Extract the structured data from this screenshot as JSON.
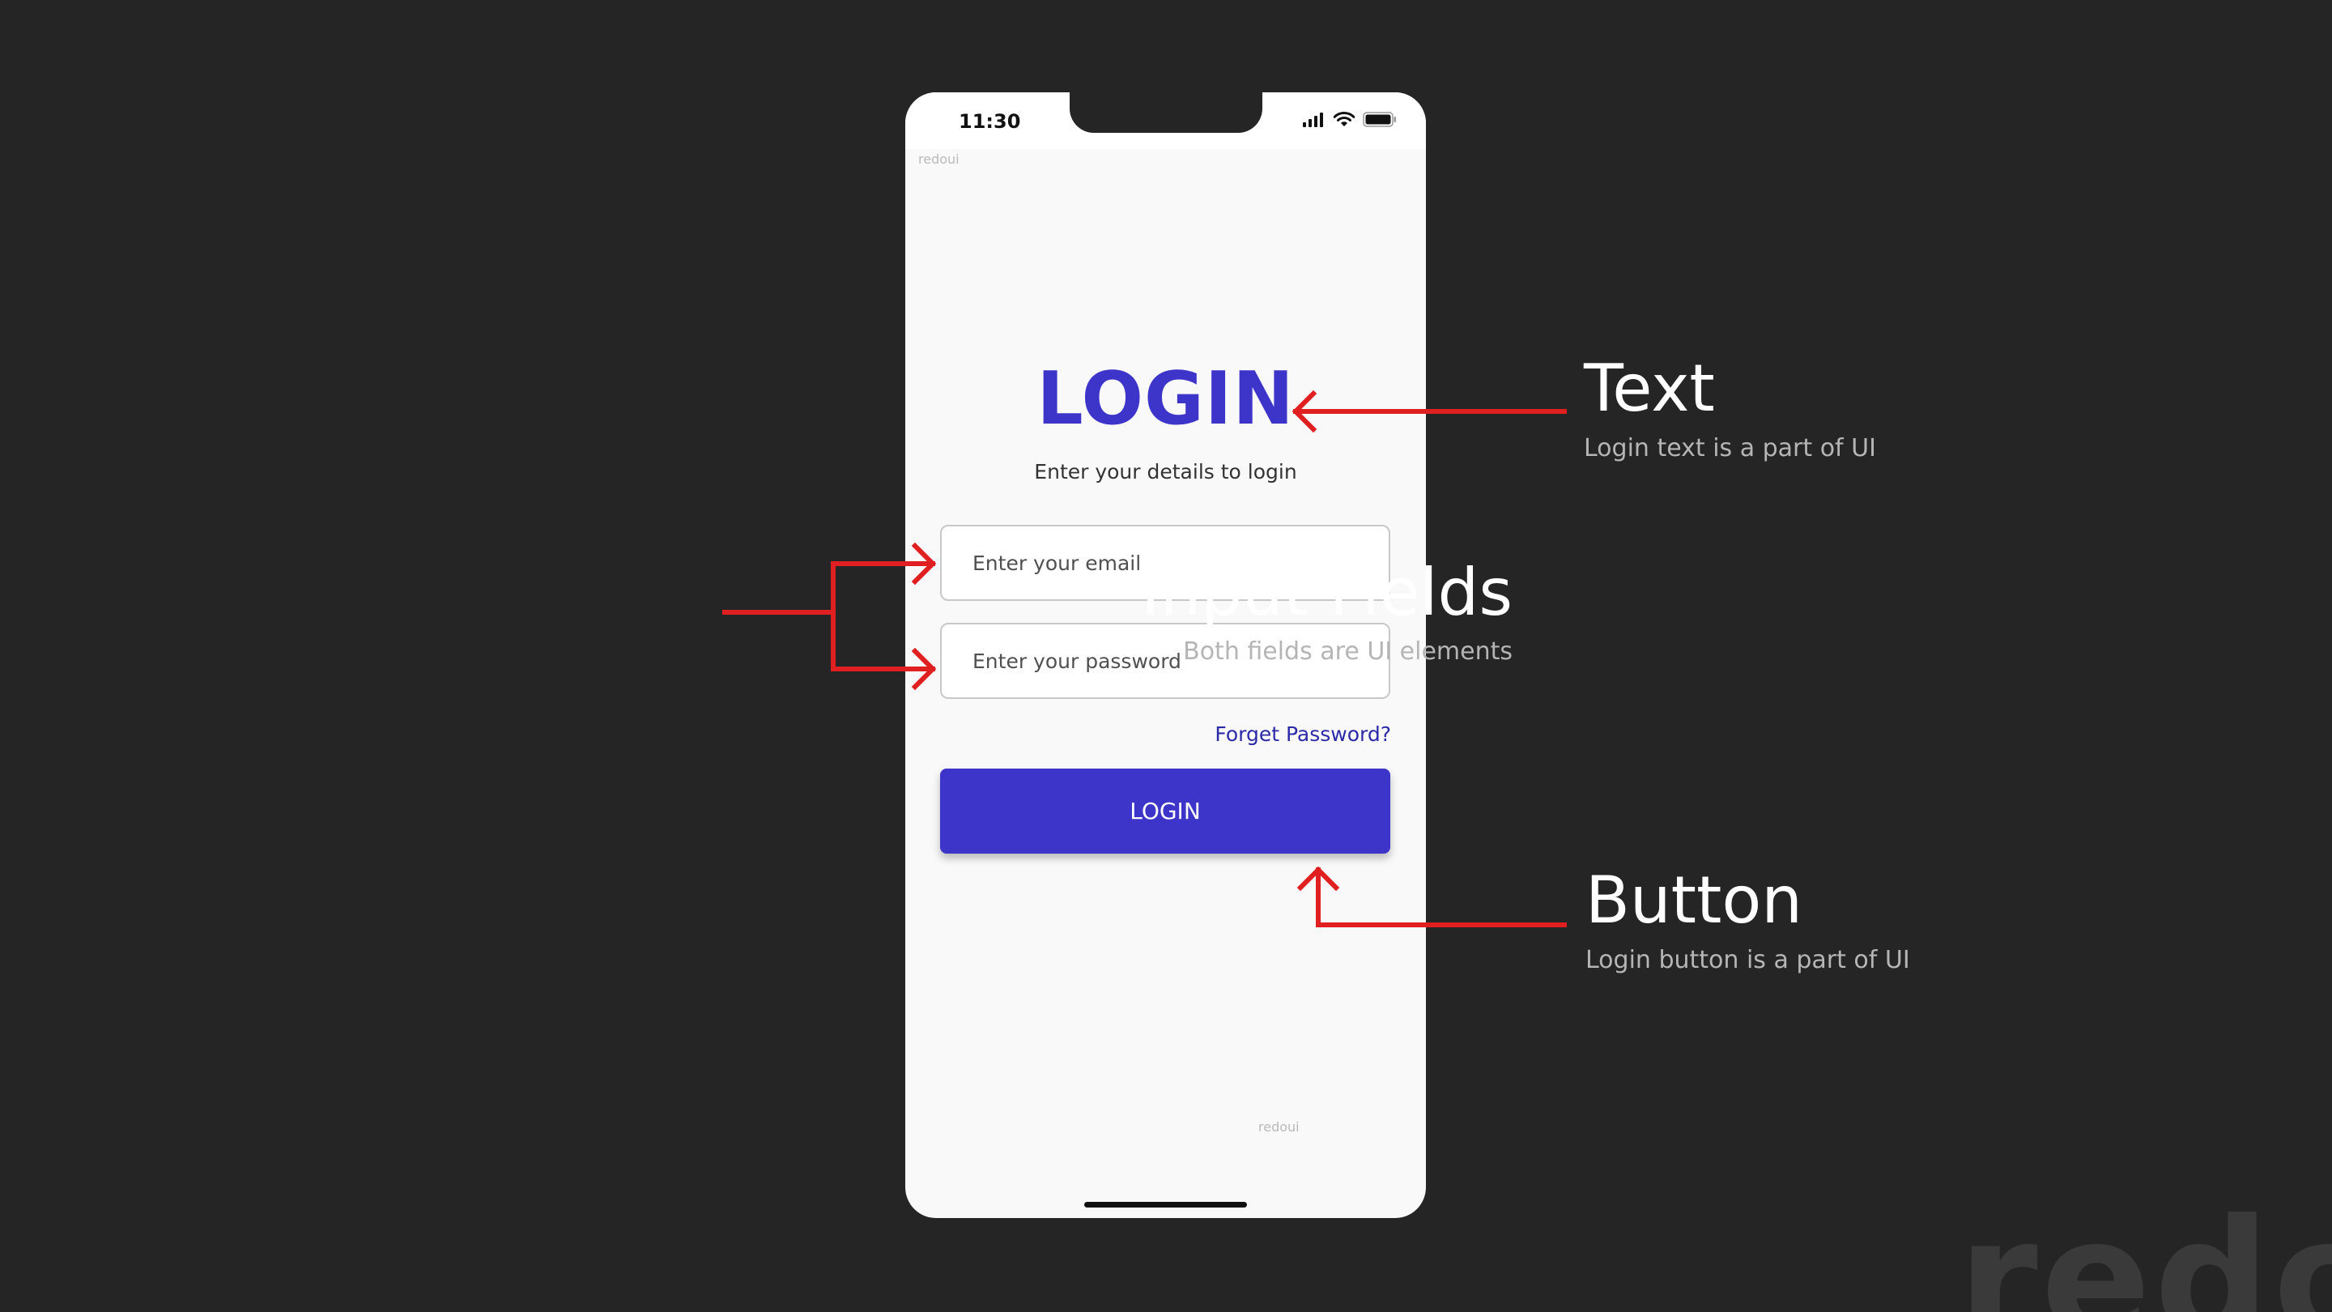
{
  "phone": {
    "status_time": "11:30",
    "watermark_top": "redoui",
    "watermark_bottom": "redoui",
    "title": "LOGIN",
    "subtitle": "Enter your details to login",
    "email_placeholder": "Enter your email",
    "password_placeholder": "Enter your password",
    "forgot_label": "Forget Password?",
    "login_button_label": "LOGIN",
    "accent_color": "#3d34c9"
  },
  "annotations": {
    "text": {
      "title": "Text",
      "subtitle": "Login text is a part of UI"
    },
    "inputs": {
      "title": "Input Fields",
      "subtitle": "Both fields are UI elements"
    },
    "button": {
      "title": "Button",
      "subtitle": "Login button is a part of UI"
    },
    "arrow_color": "#e02020"
  },
  "corner_watermark": "redoui",
  "icons": [
    "signal-icon",
    "wifi-icon",
    "battery-icon"
  ]
}
